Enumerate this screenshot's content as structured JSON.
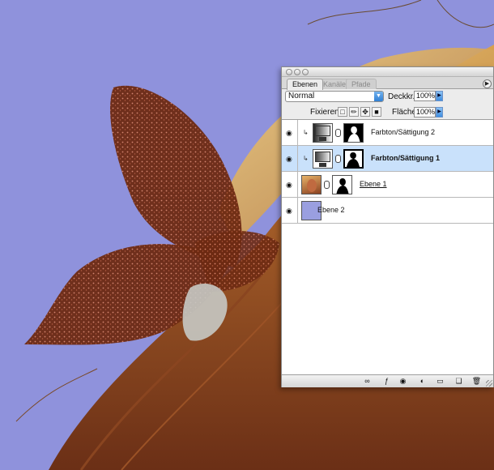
{
  "palette": {
    "tabs": [
      {
        "label": "Ebenen",
        "active": true
      },
      {
        "label": "Kanäle",
        "active": false
      },
      {
        "label": "Pfade",
        "active": false
      }
    ],
    "blend_mode": "Normal",
    "opacity_label": "Deckkr.:",
    "opacity_value": "100%",
    "lock_label": "Fixieren:",
    "fill_label": "Fläche:",
    "fill_value": "100%",
    "layers": [
      {
        "name": "Farbton/Sättigung 2",
        "type": "adjustment",
        "clipped": true,
        "selected": false
      },
      {
        "name": "Farbton/Sättigung 1",
        "type": "adjustment",
        "clipped": true,
        "selected": true
      },
      {
        "name": "Ebene 1",
        "type": "image",
        "clipped": false,
        "selected": false
      },
      {
        "name": "Ebene 2",
        "type": "fill",
        "clipped": false,
        "selected": false
      }
    ],
    "bottom_icons": [
      "link-layers",
      "layer-style",
      "layer-mask",
      "adjustment-layer",
      "new-group",
      "new-layer",
      "delete-layer"
    ]
  },
  "colors": {
    "canvas_background": "#8f92dc",
    "selected_layer": "#c9e1fb",
    "ebene2_swatch": "#9a9fe0"
  }
}
